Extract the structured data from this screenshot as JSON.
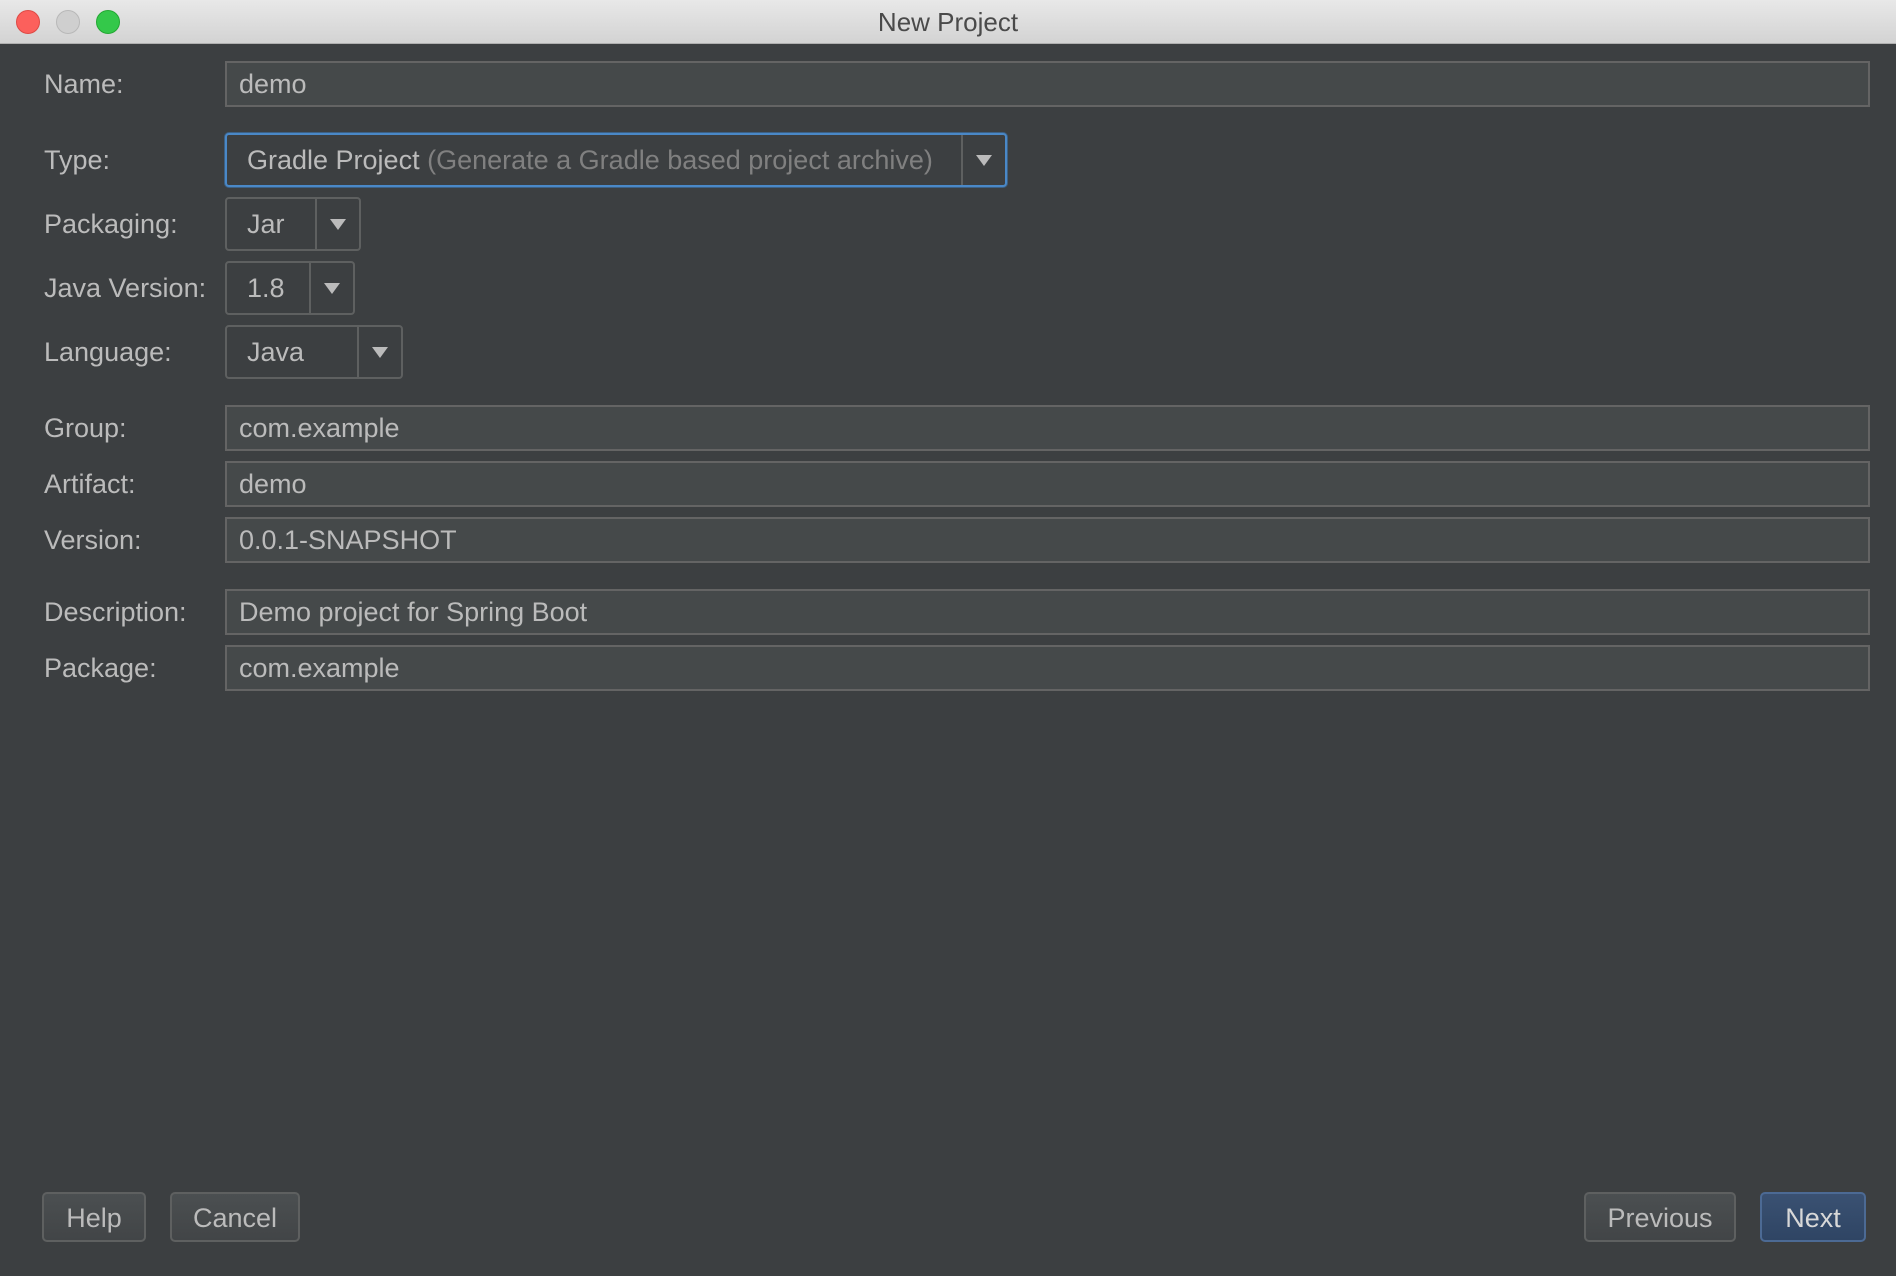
{
  "window": {
    "title": "New Project"
  },
  "form": {
    "name": {
      "label": "Name:",
      "value": "demo"
    },
    "type": {
      "label": "Type:",
      "value": "Gradle Project",
      "hint": "(Generate a Gradle based project archive)"
    },
    "packaging": {
      "label": "Packaging:",
      "value": "Jar"
    },
    "java_version": {
      "label": "Java Version:",
      "value": "1.8"
    },
    "language": {
      "label": "Language:",
      "value": "Java"
    },
    "group": {
      "label": "Group:",
      "value": "com.example"
    },
    "artifact": {
      "label": "Artifact:",
      "value": "demo"
    },
    "version": {
      "label": "Version:",
      "value": "0.0.1-SNAPSHOT"
    },
    "description": {
      "label": "Description:",
      "value": "Demo project for Spring Boot"
    },
    "package": {
      "label": "Package:",
      "value": "com.example"
    }
  },
  "buttons": {
    "help": "Help",
    "cancel": "Cancel",
    "previous": "Previous",
    "next": "Next"
  },
  "colors": {
    "background": "#3c3f41",
    "field_background": "#45494a",
    "text": "#bbbbbb",
    "focus_accent": "#4a88c7",
    "primary_button": "#365880"
  }
}
